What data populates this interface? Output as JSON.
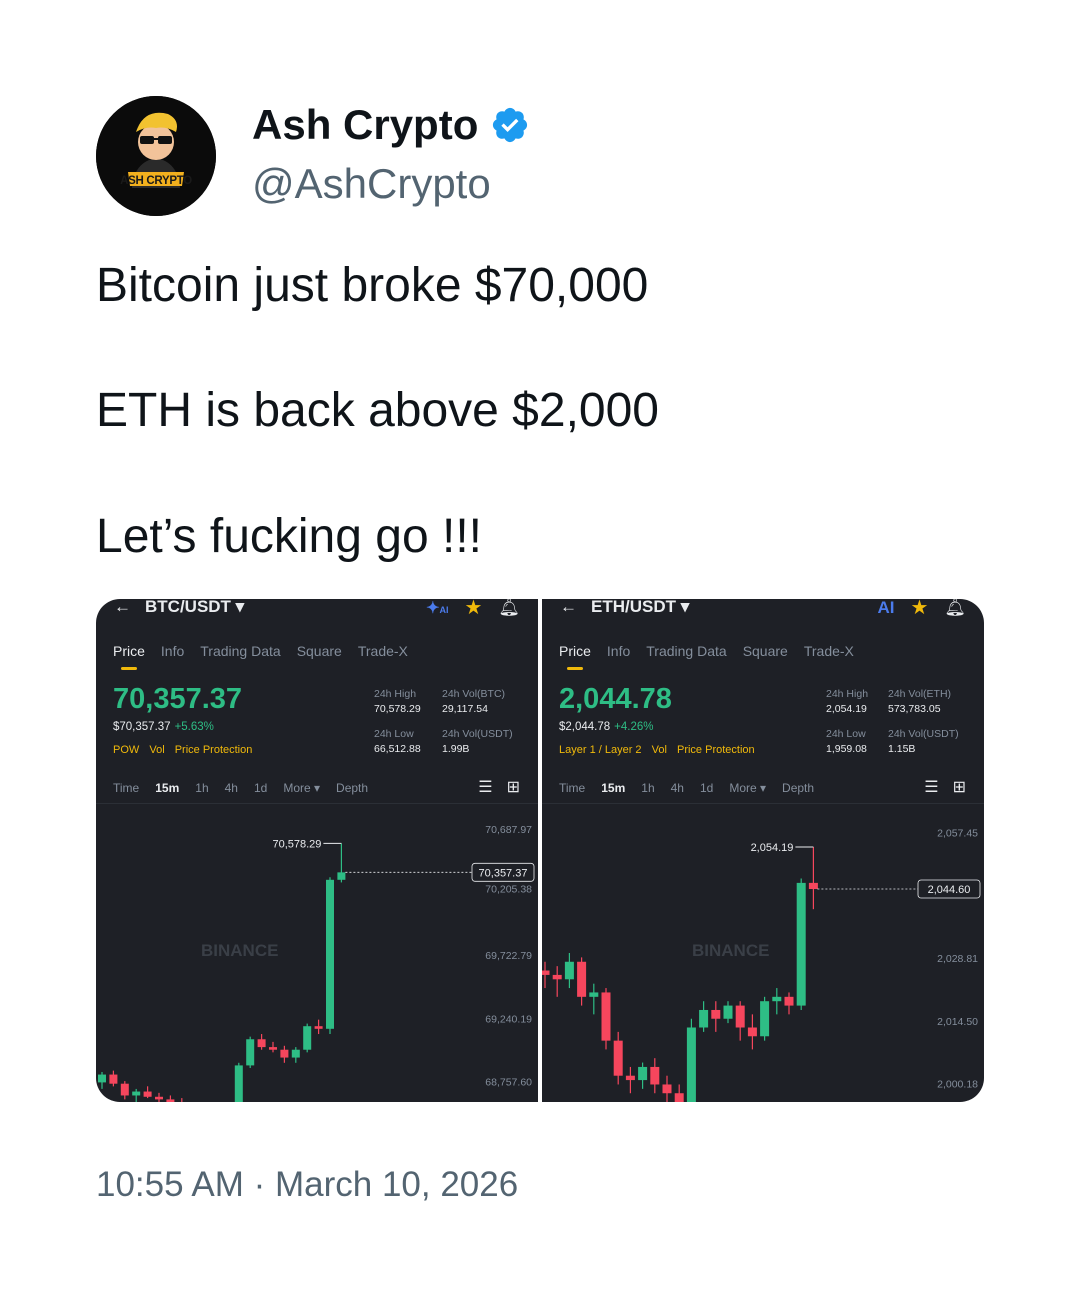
{
  "author": {
    "name": "Ash Crypto",
    "handle": "@AshCrypto",
    "avatar_text": "ASH CRYPTO",
    "verified_icon": "verified-badge-icon",
    "verified_color": "#1d9bf0"
  },
  "tweet": {
    "lines": [
      "Bitcoin just broke $70,000",
      "ETH is back above $2,000",
      "Let’s fucking go !!!"
    ]
  },
  "timestamp": "10:55 AM · March 10, 2026",
  "panels": [
    {
      "pair": "BTC/USDT ▾",
      "ai_label": "AI",
      "tabs": [
        "Price",
        "Info",
        "Trading Data",
        "Square",
        "Trade-X"
      ],
      "last_price": "70,357.37",
      "sub_price": "$70,357.37",
      "change": "+5.63%",
      "tags": [
        "POW",
        "Vol",
        "Price Protection"
      ],
      "stats": {
        "high_label": "24h High",
        "high": "70,578.29",
        "vol_base_label": "24h Vol(BTC)",
        "vol_base": "29,117.54",
        "low_label": "24h Low",
        "low": "66,512.88",
        "vol_quote_label": "24h Vol(USDT)",
        "vol_quote": "1.99B"
      },
      "intervals": [
        "Time",
        "15m",
        "1h",
        "4h",
        "1d",
        "More ▾",
        "Depth"
      ],
      "selected_interval": "15m",
      "watermark": "BINANCE"
    },
    {
      "pair": "ETH/USDT ▾",
      "ai_label": "AI",
      "tabs": [
        "Price",
        "Info",
        "Trading Data",
        "Square",
        "Trade-X"
      ],
      "last_price": "2,044.78",
      "sub_price": "$2,044.78",
      "change": "+4.26%",
      "tags": [
        "Layer 1 / Layer 2",
        "Vol",
        "Price Protection"
      ],
      "stats": {
        "high_label": "24h High",
        "high": "2,054.19",
        "vol_base_label": "24h Vol(ETH)",
        "vol_base": "573,783.05",
        "low_label": "24h Low",
        "low": "1,959.08",
        "vol_quote_label": "24h Vol(USDT)",
        "vol_quote": "1.15B"
      },
      "intervals": [
        "Time",
        "15m",
        "1h",
        "4h",
        "1d",
        "More ▾",
        "Depth"
      ],
      "selected_interval": "15m",
      "watermark": "BINANCE"
    }
  ],
  "colors": {
    "up": "#2ebd85",
    "down": "#f6465d",
    "accent": "#f0b90b",
    "panel_bg": "#1e2026"
  },
  "chart_data": [
    {
      "type": "candlestick",
      "title": "BTC/USDT 15m",
      "y_ticks": [
        70687.97,
        69722.79,
        69240.19,
        68757.6
      ],
      "y_tick_labels": [
        "70,687.97",
        "69,722.79",
        "69,240.19",
        "68,757.60"
      ],
      "ylim": [
        68600,
        70880
      ],
      "high_marker": {
        "label": "70,578.29",
        "value": 70578.29
      },
      "last_marker": {
        "label": "70,357.37",
        "value": 70357.37
      },
      "partial_tick_label": "70,205.38",
      "candles": [
        [
          68750,
          68830,
          68700,
          68810
        ],
        [
          68810,
          68840,
          68720,
          68740
        ],
        [
          68740,
          68760,
          68620,
          68650
        ],
        [
          68650,
          68700,
          68600,
          68680
        ],
        [
          68680,
          68720,
          68630,
          68640
        ],
        [
          68640,
          68670,
          68600,
          68620
        ],
        [
          68620,
          68650,
          68580,
          68600
        ],
        [
          68600,
          68630,
          68560,
          68570
        ],
        [
          68570,
          68600,
          68540,
          68560
        ],
        [
          68560,
          68590,
          68520,
          68530
        ],
        [
          68530,
          68560,
          68500,
          68520
        ],
        [
          68520,
          68550,
          68480,
          68510
        ],
        [
          68500,
          68900,
          68480,
          68880
        ],
        [
          68880,
          69100,
          68860,
          69080
        ],
        [
          69080,
          69120,
          69000,
          69020
        ],
        [
          69020,
          69060,
          68980,
          69000
        ],
        [
          69000,
          69030,
          68900,
          68940
        ],
        [
          68940,
          69020,
          68900,
          69000
        ],
        [
          69000,
          69200,
          68980,
          69180
        ],
        [
          69180,
          69230,
          69120,
          69160
        ],
        [
          69160,
          70320,
          69120,
          70300
        ],
        [
          70300,
          70578,
          70280,
          70357
        ]
      ]
    },
    {
      "type": "candlestick",
      "title": "ETH/USDT 15m",
      "y_ticks": [
        2057.45,
        2028.81,
        2014.5,
        2000.18
      ],
      "y_tick_labels": [
        "2,057.45",
        "2,028.81",
        "2,014.50",
        "2,000.18"
      ],
      "ylim": [
        1996,
        2064
      ],
      "high_marker": {
        "label": "2,054.19",
        "value": 2054.19
      },
      "last_marker": {
        "label": "2,044.60",
        "value": 2044.6
      },
      "candles": [
        [
          2026,
          2028,
          2022,
          2025
        ],
        [
          2025,
          2027,
          2020,
          2024
        ],
        [
          2024,
          2030,
          2022,
          2028
        ],
        [
          2028,
          2029,
          2018,
          2020
        ],
        [
          2020,
          2023,
          2016,
          2021
        ],
        [
          2021,
          2022,
          2008,
          2010
        ],
        [
          2010,
          2012,
          2000,
          2002
        ],
        [
          2002,
          2004,
          1998,
          2001
        ],
        [
          2001,
          2005,
          1999,
          2004
        ],
        [
          2004,
          2006,
          1998,
          2000
        ],
        [
          2000,
          2002,
          1996,
          1998
        ],
        [
          1998,
          2000,
          1995,
          1996
        ],
        [
          1996,
          2015,
          1995,
          2013
        ],
        [
          2013,
          2019,
          2012,
          2017
        ],
        [
          2017,
          2019,
          2012,
          2015
        ],
        [
          2015,
          2019,
          2014,
          2018
        ],
        [
          2018,
          2019,
          2010,
          2013
        ],
        [
          2013,
          2016,
          2008,
          2011
        ],
        [
          2011,
          2020,
          2010,
          2019
        ],
        [
          2019,
          2022,
          2016,
          2020
        ],
        [
          2020,
          2021,
          2016,
          2018
        ],
        [
          2018,
          2047,
          2017,
          2046
        ],
        [
          2046,
          2054.19,
          2040,
          2044.6
        ]
      ]
    }
  ]
}
